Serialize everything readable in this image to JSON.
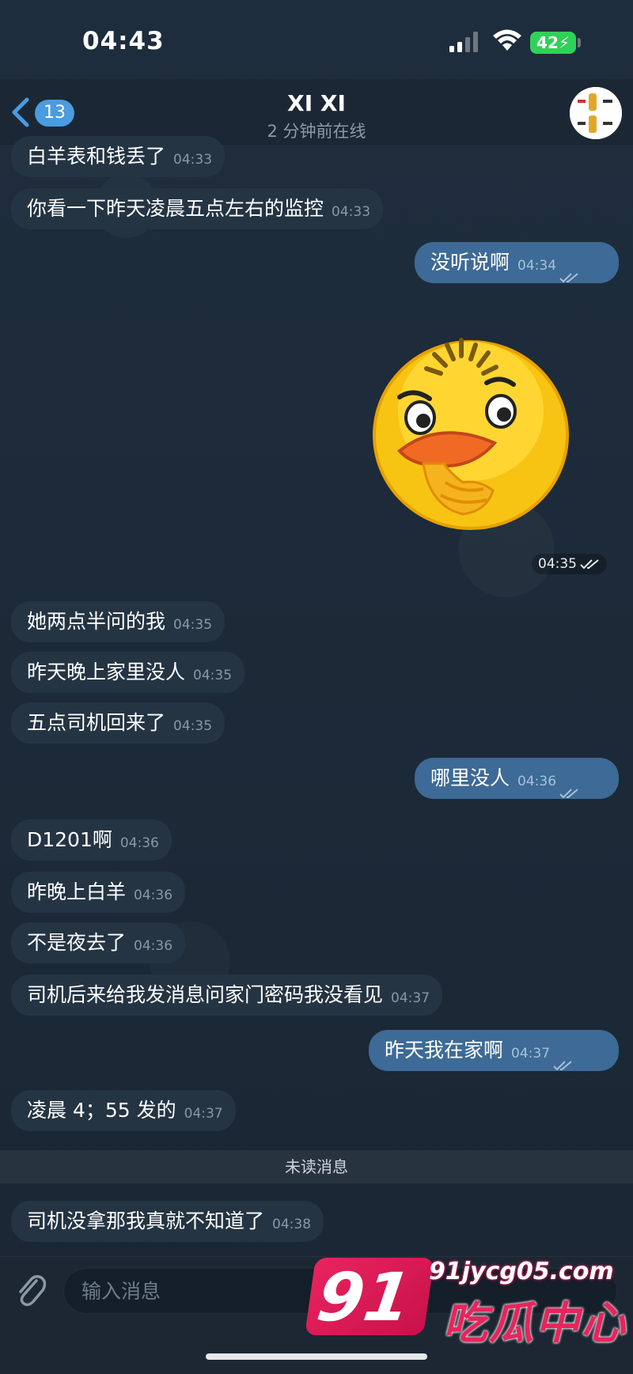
{
  "status_bar": {
    "time": "04:43",
    "battery": "42"
  },
  "header": {
    "back_count": "13",
    "title": "XI XI",
    "status": "2 分钟前在线"
  },
  "messages": [
    {
      "text": "白羊表和钱丢了",
      "time": "04:33"
    },
    {
      "text": "你看一下昨天凌晨五点左右的监控",
      "time": "04:33"
    },
    {
      "text": "没听说啊",
      "time": "04:34"
    },
    {
      "text": "她两点半问的我",
      "time": "04:35"
    },
    {
      "text": "昨天晚上家里没人",
      "time": "04:35"
    },
    {
      "text": "五点司机回来了",
      "time": "04:35"
    },
    {
      "text": "哪里没人",
      "time": "04:36"
    },
    {
      "text": "D1201啊",
      "time": "04:36"
    },
    {
      "text": "昨晚上白羊",
      "time": "04:36"
    },
    {
      "text": "不是夜去了",
      "time": "04:36"
    },
    {
      "text": "司机后来给我发消息问家门密码我没看见",
      "time": "04:37"
    },
    {
      "text": "昨天我在家啊",
      "time": "04:37"
    },
    {
      "text": "凌晨 4；55 发的",
      "time": "04:37"
    },
    {
      "text": "司机没拿那我真就不知道了",
      "time": "04:38"
    }
  ],
  "sticker": {
    "time": "04:35",
    "icon": "duck-sticker"
  },
  "unread_divider": "未读消息",
  "input": {
    "placeholder": "输入消息"
  },
  "watermark": {
    "badge": "91",
    "domain": "91jycg05.com",
    "name": "吃瓜中心"
  },
  "colors": {
    "incoming_bubble": "#243443",
    "outgoing_bubble": "#3d6a96",
    "accent": "#4a9be0"
  }
}
